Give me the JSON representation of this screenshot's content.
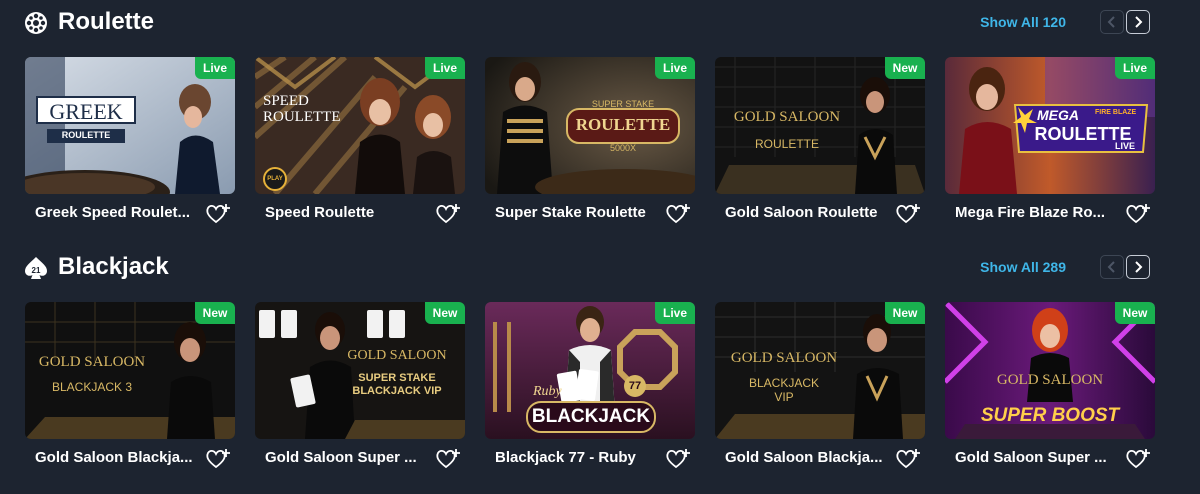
{
  "sections": [
    {
      "title": "Roulette",
      "icon": "roulette-icon",
      "show_all": "Show All 120",
      "games": [
        {
          "name": "Greek Speed Roulet...",
          "badge": "Live",
          "art": [
            "GREEK",
            "ROULETTE"
          ]
        },
        {
          "name": "Speed Roulette",
          "badge": "Live",
          "art": [
            "SPEED",
            "ROULETTE",
            "PLAY"
          ]
        },
        {
          "name": "Super Stake Roulette",
          "badge": "Live",
          "art": [
            "SUPER STAKE",
            "ROULETTE",
            "5000X"
          ]
        },
        {
          "name": "Gold Saloon Roulette",
          "badge": "New",
          "art": [
            "GOLD SALOON",
            "ROULETTE"
          ]
        },
        {
          "name": "Mega Fire Blaze Ro...",
          "badge": "Live",
          "art": [
            "MEGA",
            "FIRE BLAZE",
            "ROULETTE",
            "LIVE"
          ]
        }
      ]
    },
    {
      "title": "Blackjack",
      "icon": "blackjack-icon",
      "show_all": "Show All 289",
      "games": [
        {
          "name": "Gold Saloon Blackja...",
          "badge": "New",
          "art": [
            "GOLD SALOON",
            "BLACKJACK 3"
          ]
        },
        {
          "name": "Gold Saloon Super ...",
          "badge": "New",
          "art": [
            "GOLD SALOON",
            "SUPER STAKE",
            "BLACKJACK VIP"
          ]
        },
        {
          "name": "Blackjack 77 - Ruby",
          "badge": "Live",
          "art": [
            "Ruby",
            "BLACKJACK",
            "77"
          ]
        },
        {
          "name": "Gold Saloon Blackja...",
          "badge": "New",
          "art": [
            "GOLD SALOON",
            "BLACKJACK",
            "VIP"
          ]
        },
        {
          "name": "Gold Saloon Super ...",
          "badge": "New",
          "art": [
            "GOLD SALOON",
            "SUPER BOOST"
          ]
        }
      ]
    }
  ],
  "colors": {
    "background": "#1d2430",
    "accent": "#3fb6e8",
    "badge": "#19b14f",
    "gold": "#d8b865"
  }
}
